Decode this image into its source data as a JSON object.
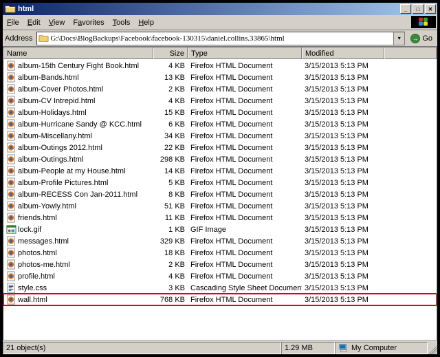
{
  "window": {
    "title": "html"
  },
  "menubar": {
    "file": "File",
    "edit": "Edit",
    "view": "View",
    "favorites": "Favorites",
    "tools": "Tools",
    "help": "Help"
  },
  "addressbar": {
    "label": "Address",
    "path": "G:\\Docs\\BlogBackups\\Facebook\\facebook-130315\\daniel.collins.33865\\html",
    "go": "Go"
  },
  "columns": {
    "name": "Name",
    "size": "Size",
    "type": "Type",
    "modified": "Modified"
  },
  "files": [
    {
      "icon": "ff",
      "name": "album-15th Century Fight Book.html",
      "size": "4 KB",
      "type": "Firefox HTML Document",
      "modified": "3/15/2013 5:13 PM"
    },
    {
      "icon": "ff",
      "name": "album-Bands.html",
      "size": "13 KB",
      "type": "Firefox HTML Document",
      "modified": "3/15/2013 5:13 PM"
    },
    {
      "icon": "ff",
      "name": "album-Cover Photos.html",
      "size": "2 KB",
      "type": "Firefox HTML Document",
      "modified": "3/15/2013 5:13 PM"
    },
    {
      "icon": "ff",
      "name": "album-CV Intrepid.html",
      "size": "4 KB",
      "type": "Firefox HTML Document",
      "modified": "3/15/2013 5:13 PM"
    },
    {
      "icon": "ff",
      "name": "album-Holidays.html",
      "size": "15 KB",
      "type": "Firefox HTML Document",
      "modified": "3/15/2013 5:13 PM"
    },
    {
      "icon": "ff",
      "name": "album-Hurricane Sandy @ KCC.html",
      "size": "6 KB",
      "type": "Firefox HTML Document",
      "modified": "3/15/2013 5:13 PM"
    },
    {
      "icon": "ff",
      "name": "album-Miscellany.html",
      "size": "34 KB",
      "type": "Firefox HTML Document",
      "modified": "3/15/2013 5:13 PM"
    },
    {
      "icon": "ff",
      "name": "album-Outings 2012.html",
      "size": "22 KB",
      "type": "Firefox HTML Document",
      "modified": "3/15/2013 5:13 PM"
    },
    {
      "icon": "ff",
      "name": "album-Outings.html",
      "size": "298 KB",
      "type": "Firefox HTML Document",
      "modified": "3/15/2013 5:13 PM"
    },
    {
      "icon": "ff",
      "name": "album-People at my House.html",
      "size": "14 KB",
      "type": "Firefox HTML Document",
      "modified": "3/15/2013 5:13 PM"
    },
    {
      "icon": "ff",
      "name": "album-Profile Pictures.html",
      "size": "5 KB",
      "type": "Firefox HTML Document",
      "modified": "3/15/2013 5:13 PM"
    },
    {
      "icon": "ff",
      "name": "album-RECESS Con Jan-2011.html",
      "size": "8 KB",
      "type": "Firefox HTML Document",
      "modified": "3/15/2013 5:13 PM"
    },
    {
      "icon": "ff",
      "name": "album-Yowly.html",
      "size": "51 KB",
      "type": "Firefox HTML Document",
      "modified": "3/15/2013 5:13 PM"
    },
    {
      "icon": "ff",
      "name": "friends.html",
      "size": "11 KB",
      "type": "Firefox HTML Document",
      "modified": "3/15/2013 5:13 PM"
    },
    {
      "icon": "gif",
      "name": "lock.gif",
      "size": "1 KB",
      "type": "GIF Image",
      "modified": "3/15/2013 5:13 PM"
    },
    {
      "icon": "ff",
      "name": "messages.html",
      "size": "329 KB",
      "type": "Firefox HTML Document",
      "modified": "3/15/2013 5:13 PM"
    },
    {
      "icon": "ff",
      "name": "photos.html",
      "size": "18 KB",
      "type": "Firefox HTML Document",
      "modified": "3/15/2013 5:13 PM"
    },
    {
      "icon": "ff",
      "name": "photos-me.html",
      "size": "2 KB",
      "type": "Firefox HTML Document",
      "modified": "3/15/2013 5:13 PM"
    },
    {
      "icon": "ff",
      "name": "profile.html",
      "size": "4 KB",
      "type": "Firefox HTML Document",
      "modified": "3/15/2013 5:13 PM"
    },
    {
      "icon": "css",
      "name": "style.css",
      "size": "3 KB",
      "type": "Cascading Style Sheet Document",
      "modified": "3/15/2013 5:13 PM"
    },
    {
      "icon": "ff",
      "name": "wall.html",
      "size": "768 KB",
      "type": "Firefox HTML Document",
      "modified": "3/15/2013 5:13 PM",
      "highlight": true
    }
  ],
  "statusbar": {
    "count": "21 object(s)",
    "size": "1.29 MB",
    "location": "My Computer"
  }
}
